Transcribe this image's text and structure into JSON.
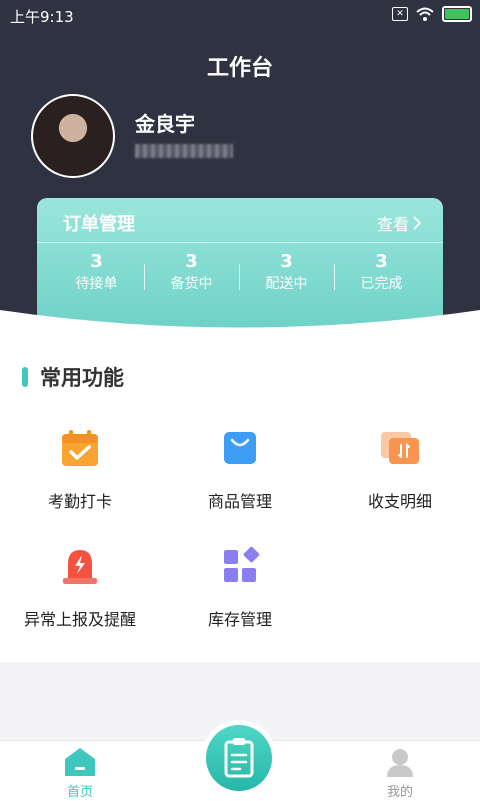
{
  "status_bar": {
    "time": "上午9:13"
  },
  "header": {
    "title": "工作台"
  },
  "user": {
    "name": "金良宇"
  },
  "order": {
    "title": "订单管理",
    "view_label": "查看",
    "stats": [
      {
        "count": "3",
        "label": "待接单"
      },
      {
        "count": "3",
        "label": "备货中"
      },
      {
        "count": "3",
        "label": "配送中"
      },
      {
        "count": "3",
        "label": "已完成"
      }
    ]
  },
  "functions": {
    "title": "常用功能",
    "items": [
      {
        "label": "考勤打卡",
        "icon": "calendar-check-icon"
      },
      {
        "label": "商品管理",
        "icon": "shopping-bag-icon"
      },
      {
        "label": "收支明细",
        "icon": "transfer-cards-icon"
      },
      {
        "label": "异常上报及提醒",
        "icon": "alarm-light-icon"
      },
      {
        "label": "库存管理",
        "icon": "apps-grid-icon"
      }
    ]
  },
  "tabbar": {
    "home_label": "首页",
    "mine_label": "我的"
  },
  "colors": {
    "accent": "#3fc7bd",
    "header_bg": "#2f3240"
  }
}
